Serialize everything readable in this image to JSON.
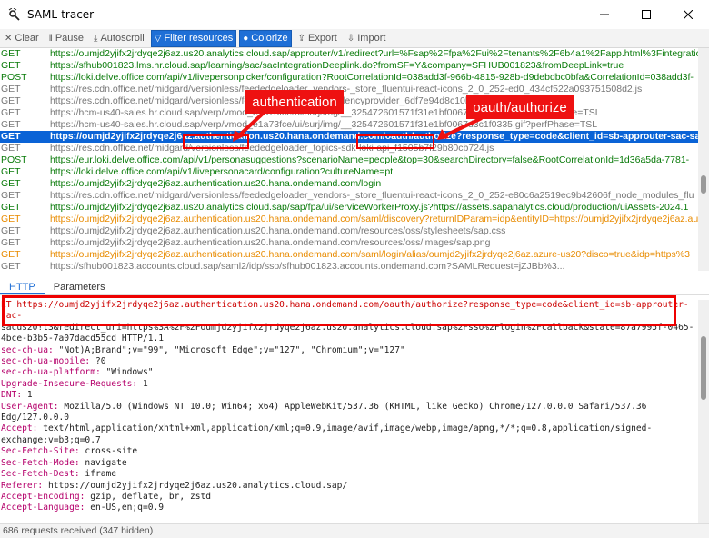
{
  "window": {
    "title": "SAML-tracer"
  },
  "toolbar": {
    "clear": "Clear",
    "pause": "Pause",
    "autoscroll": "Autoscroll",
    "filter": "Filter resources",
    "colorize": "Colorize",
    "export": "Export",
    "import": "Import"
  },
  "requests": [
    {
      "method": "GET",
      "url": "https://oumjd2yjifx2jrdyqe2j6az.us20.analytics.cloud.sap/approuter/v1/redirect?url=%Fsap%2Ffpa%2Fui%2Ftenants%2F6b4a1%2Fapp.html%3Fintegration",
      "style": "get"
    },
    {
      "method": "GET",
      "url": "https://sfhub001823.lms.hr.cloud.sap/learning/sac/sacIntegrationDeeplink.do?fromSF=Y&company=SFHUB001823&fromDeepLink=true",
      "style": "get"
    },
    {
      "method": "POST",
      "url": "https://loki.delve.office.com/api/v1/livepersonpicker/configuration?RootCorrelationId=038add3f-966b-4815-928b-d9debdbc0bfa&CorrelationId=038add3f-",
      "style": "post"
    },
    {
      "method": "GET",
      "url": "https://res.cdn.office.net/midgard/versionless/feededgeloader_vendors-_store_fluentui-react-icons_2_0_252-ed0_434cf522a093751508d2.js",
      "style": "grey"
    },
    {
      "method": "GET",
      "url": "https://res.cdn.office.net/midgard/versionless/feededgeloader_dependencyprovider_6df7e94d8c10bf5ee2f0.js",
      "style": "grey"
    },
    {
      "method": "GET",
      "url": "https://hcm-us40-sales.hr.cloud.sap/verp/vmod_e1a73fce/ui/surj/img/__325472601571f31e1bf0067d66ed0397.gif?perfPhase=TSL",
      "style": "grey"
    },
    {
      "method": "GET",
      "url": "https://hcm-us40-sales.hr.cloud.sap/verp/vmod_e1a73fce/ui/surj/img/__325472601571f31e1bf0067d3c1f0335.gif?perfPhase=TSL",
      "style": "grey"
    },
    {
      "method": "GET",
      "url": "https://oumjd2yjifx2jrdyqe2j6az.authentication.us20.hana.ondemand.com/oauth/authorize?response_type=code&client_id=sb-approuter-sac-sacus20!t3",
      "style": "sel"
    },
    {
      "method": "GET",
      "url": "https://res.cdn.office.net/midgard/versionless/feededgeloader_topics-sdk-loki-api_f1505b7f29b80cb724.js",
      "style": "grey"
    },
    {
      "method": "POST",
      "url": "https://eur.loki.delve.office.com/api/v1/personasuggestions?scenarioName=people&top=30&searchDirectory=false&RootCorrelationId=1d36a5da-7781-",
      "style": "post"
    },
    {
      "method": "GET",
      "url": "https://loki.delve.office.com/api/v1/livepersonacard/configuration?cultureName=pt",
      "style": "get"
    },
    {
      "method": "GET",
      "url": "https://oumjd2yjifx2jrdyqe2j6az.authentication.us20.hana.ondemand.com/login",
      "style": "get"
    },
    {
      "method": "GET",
      "url": "https://res.cdn.office.net/midgard/versionless/feededgeloader_vendors-_store_fluentui-react-icons_2_0_252-e80c6a2519ec9b42606f_node_modules_flu",
      "style": "grey"
    },
    {
      "method": "GET",
      "url": "https://oumjd2yjifx2jrdyqe2j6az.us20.analytics.cloud.sap/sap/fpa/ui/serviceWorkerProxy.js?https://assets.sapanalytics.cloud/production/uiAssets-2024.1",
      "style": "get"
    },
    {
      "method": "GET",
      "url": "https://oumjd2yjifx2jrdyqe2j6az.authentication.us20.hana.ondemand.com/saml/discovery?returnIDParam=idp&entityID=https://oumjd2yjifx2jrdyqe2j6az.au",
      "style": "orange"
    },
    {
      "method": "GET",
      "url": "https://oumjd2yjifx2jrdyqe2j6az.authentication.us20.hana.ondemand.com/resources/oss/stylesheets/sap.css",
      "style": "grey"
    },
    {
      "method": "GET",
      "url": "https://oumjd2yjifx2jrdyqe2j6az.authentication.us20.hana.ondemand.com/resources/oss/images/sap.png",
      "style": "grey"
    },
    {
      "method": "GET",
      "url": "https://oumjd2yjifx2jrdyqe2j6az.authentication.us20.hana.ondemand.com/saml/login/alias/oumjd2yjifx2jrdyqe2j6az.azure-us20?disco=true&idp=https%3",
      "style": "orange"
    },
    {
      "method": "GET",
      "url": "https://sfhub001823.accounts.cloud.sap/saml2/idp/sso/sfhub001823.accounts.ondemand.com?SAMLRequest=jZJBb%3...",
      "style": "grey"
    }
  ],
  "detail_tabs": [
    "HTTP",
    "Parameters"
  ],
  "http_lines": [
    {
      "text": "ET https://oumjd2yjifx2jrdyqe2j6az.authentication.us20.hana.ondemand.com/oauth/authorize?response_type=code&client_id=sb-approuter-sac-",
      "first": true
    },
    {
      "text": "sacus20!t3&redirect_uri=https%3A%2F%2Foumjd2yjifx2jrdyqe2j6az.us20.analytics.cloud.sap%2Fsso%2Flogin%2Fcallback&state=87a7995f-0465-4bce-b3b5-7a07dacd55cd HTTP/1.1"
    },
    {
      "key": "sec-ch-ua:",
      "val": " \"Not)A;Brand\";v=\"99\", \"Microsoft Edge\";v=\"127\", \"Chromium\";v=\"127\""
    },
    {
      "key": "sec-ch-ua-mobile:",
      "val": " ?0"
    },
    {
      "key": "sec-ch-ua-platform:",
      "val": " \"Windows\""
    },
    {
      "key": "Upgrade-Insecure-Requests:",
      "val": " 1"
    },
    {
      "key": "DNT:",
      "val": " 1"
    },
    {
      "key": "User-Agent:",
      "val": " Mozilla/5.0 (Windows NT 10.0; Win64; x64) AppleWebKit/537.36 (KHTML, like Gecko) Chrome/127.0.0.0 Safari/537.36 Edg/127.0.0.0"
    },
    {
      "key": "Accept:",
      "val": " text/html,application/xhtml+xml,application/xml;q=0.9,image/avif,image/webp,image/apng,*/*;q=0.8,application/signed-exchange;v=b3;q=0.7"
    },
    {
      "key": "Sec-Fetch-Site:",
      "val": " cross-site"
    },
    {
      "key": "Sec-Fetch-Mode:",
      "val": " navigate"
    },
    {
      "key": "Sec-Fetch-Dest:",
      "val": " iframe"
    },
    {
      "key": "Referer:",
      "val": " https://oumjd2yjifx2jrdyqe2j6az.us20.analytics.cloud.sap/"
    },
    {
      "key": "Accept-Encoding:",
      "val": " gzip, deflate, br, zstd"
    },
    {
      "key": "Accept-Language:",
      "val": " en-US,en;q=0.9"
    }
  ],
  "status": "686 requests received (347 hidden)",
  "callouts": {
    "auth": "authentication",
    "oauth": "oauth/authorize"
  },
  "colors": {
    "accent": "#1f6fd6",
    "selected": "#0a63d6",
    "highlight": "#e00000"
  }
}
